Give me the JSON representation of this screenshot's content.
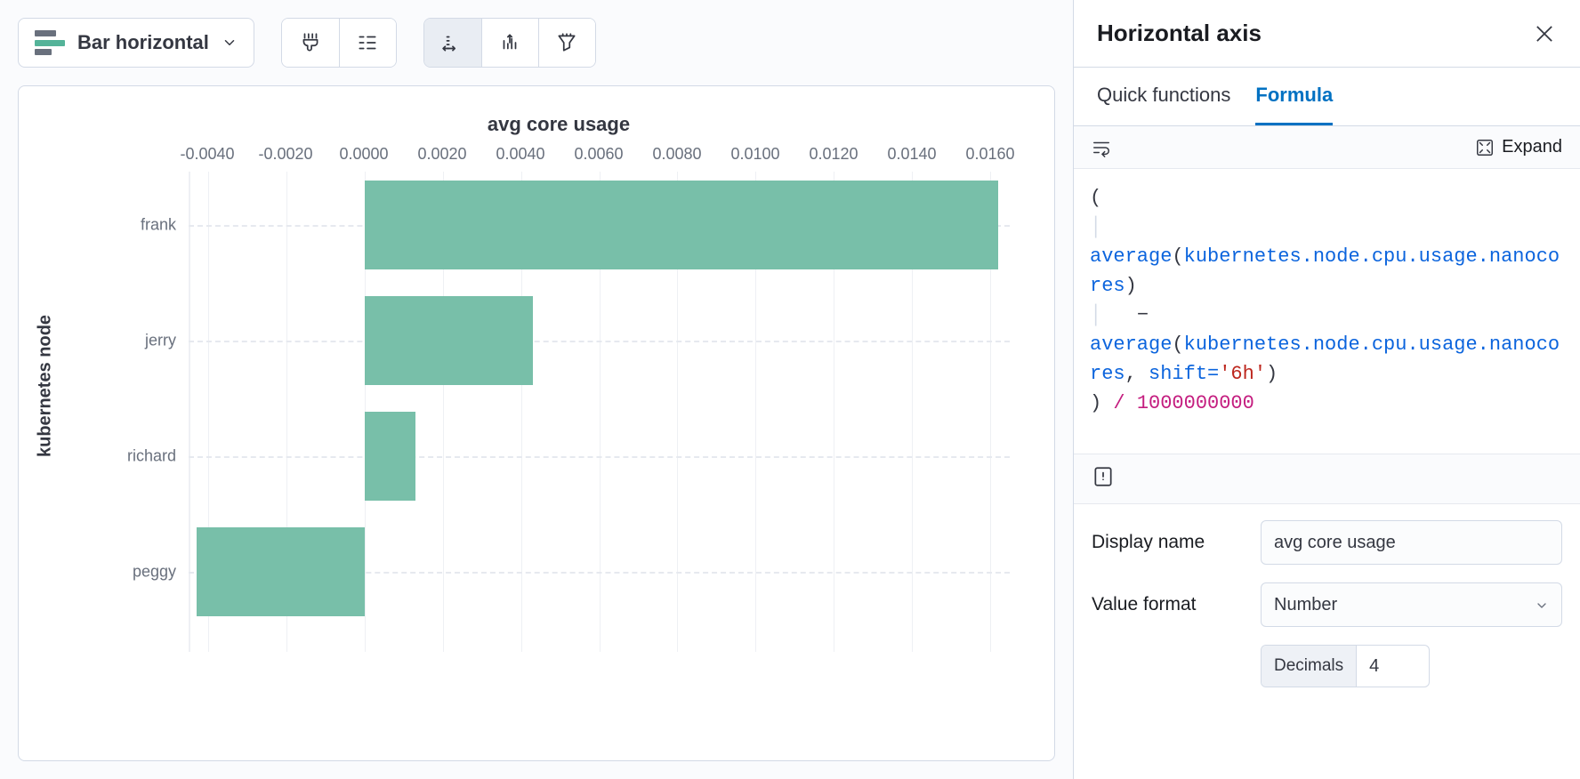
{
  "toolbar": {
    "chart_type_label": "Bar horizontal"
  },
  "panel": {
    "title": "Horizontal axis",
    "tabs": {
      "quick": "Quick functions",
      "formula": "Formula"
    },
    "expand_label": "Expand",
    "display_name_label": "Display name",
    "display_name_value": "avg core usage",
    "value_format_label": "Value format",
    "value_format_value": "Number",
    "decimals_label": "Decimals",
    "decimals_value": "4"
  },
  "formula_tokens": {
    "open_paren": "(",
    "avg1": "average",
    "op_paren": "(",
    "metric": "kubernetes.node.cpu.usage.nanocores",
    "cl_paren": ")",
    "minus": "−",
    "avg2": "average",
    "comma_shift": ", ",
    "shift_key": "shift=",
    "shift_val": "'6h'",
    "close_paren": ")",
    "outer_close": ")",
    "div": "/",
    "billion": "1000000000"
  },
  "chart_data": {
    "type": "bar",
    "orientation": "horizontal",
    "title": "avg core usage",
    "ylabel": "kubernetes node",
    "xlabel": "",
    "x_ticks": [
      -0.004,
      -0.002,
      0.0,
      0.002,
      0.004,
      0.006,
      0.008,
      0.01,
      0.012,
      0.014,
      0.016
    ],
    "x_tick_labels": [
      "-0.0040",
      "-0.0020",
      "0.0000",
      "0.0020",
      "0.0040",
      "0.0060",
      "0.0080",
      "0.0100",
      "0.0120",
      "0.0140",
      "0.0160"
    ],
    "xlim": [
      -0.0045,
      0.0165
    ],
    "categories": [
      "frank",
      "jerry",
      "richard",
      "peggy"
    ],
    "values": [
      0.0162,
      0.0043,
      0.0013,
      -0.0043
    ],
    "bar_color": "#78bfa9"
  }
}
